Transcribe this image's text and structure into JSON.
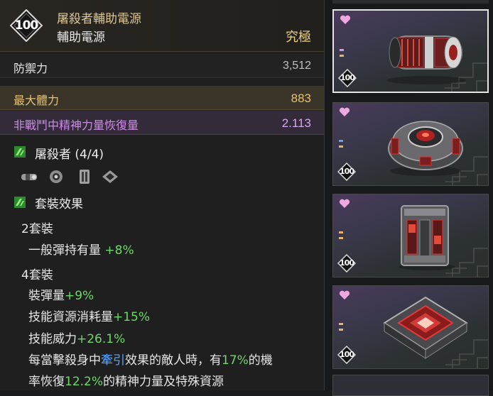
{
  "tooltip": {
    "level": "100",
    "name": "屠殺者輔助電源",
    "type": "輔助電源",
    "rarity": "究極",
    "stats": [
      {
        "label": "防禦力",
        "value": "3,512"
      },
      {
        "label": "最大體力",
        "value": "883"
      },
      {
        "label": "非戰鬥中精神力量恢復量",
        "value": "2.113"
      }
    ],
    "set_name": "屠殺者 (4/4)",
    "set_parts_icons": [
      "reactor-cylinder-icon",
      "reactor-ring-icon",
      "reactor-block-icon",
      "reactor-square-icon"
    ],
    "set_effect_title": "套裝效果",
    "bonus2": {
      "title": "2套裝",
      "lines": [
        {
          "text": "一般彈持有量",
          "value": "+8%"
        }
      ]
    },
    "bonus4": {
      "title": "4套裝",
      "lines": [
        {
          "text": "裝彈量",
          "value": "+9%"
        },
        {
          "text": "技能資源消耗量",
          "value": "+15%"
        },
        {
          "text": "技能威力",
          "value": "+26.1%"
        }
      ],
      "desc": {
        "p1": "每當擊殺身中",
        "kw": "牽引",
        "p2": "效果的敵人時，有",
        "v1": "17%",
        "p3": "的機",
        "p4": "率恢復",
        "v2": "12.2%",
        "p5": "的精神力量及特殊資源"
      }
    }
  },
  "inventory": {
    "slots": [
      {
        "level": "100",
        "icon": "reactor-cylinder-icon",
        "selected": true
      },
      {
        "level": "100",
        "icon": "reactor-ring-icon",
        "selected": false
      },
      {
        "level": "100",
        "icon": "reactor-block-icon",
        "selected": false
      },
      {
        "level": "100",
        "icon": "reactor-square-icon",
        "selected": false
      }
    ],
    "favorite_icon": "heart-icon"
  },
  "colors": {
    "gold": "#e9cf83",
    "hp": "#e8c26a",
    "mp": "#d7a6f0",
    "bonus_green": "#6fd86a",
    "keyword_blue": "#5aa6ff",
    "item_red": "#d23a3a"
  }
}
